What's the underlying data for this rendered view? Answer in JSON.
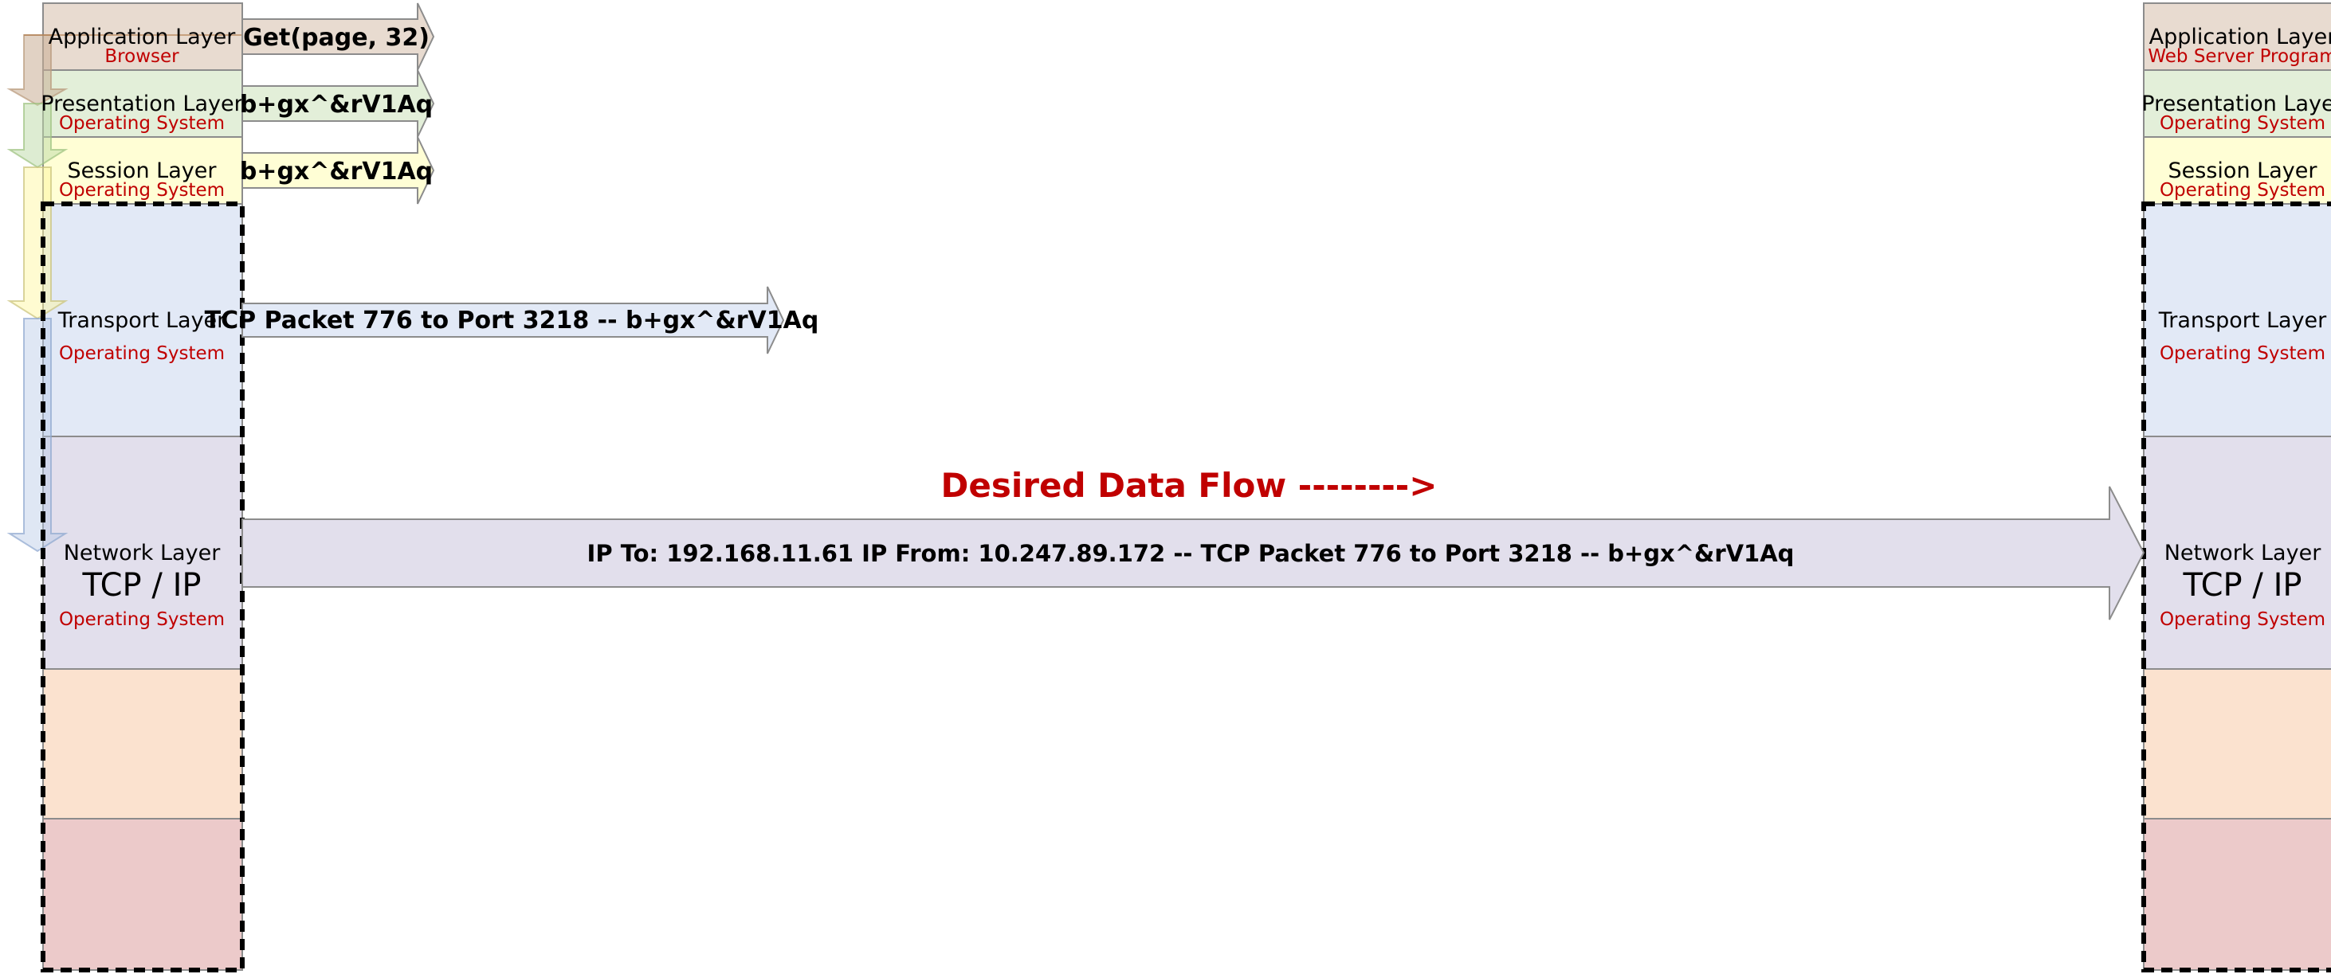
{
  "colors": {
    "application": "#e8dbd0",
    "presentation": "#e3efd9",
    "session": "#fffed5",
    "transport": "#e2e9f6",
    "network": "#e2dfec",
    "datalink": "#fbe2cf",
    "physical": "#eccaca",
    "subtitle": "#c00000",
    "title": "#c00000"
  },
  "left_stack": {
    "application": {
      "name": "Application Layer",
      "sub": "Browser"
    },
    "presentation": {
      "name": "Presentation Layer",
      "sub": "Operating System"
    },
    "session": {
      "name": "Session Layer",
      "sub": "Operating System"
    },
    "transport": {
      "name": "Transport Layer",
      "sub": "Operating System"
    },
    "network": {
      "name": "Network Layer",
      "big": "TCP / IP",
      "sub": "Operating System"
    }
  },
  "right_stack": {
    "application": {
      "name": "Application Layer",
      "sub": "Web  Server Program"
    },
    "presentation": {
      "name": "Presentation Layer",
      "sub": "Operating System"
    },
    "session": {
      "name": "Session Layer",
      "sub": "Operating System"
    },
    "transport": {
      "name": "Transport Layer",
      "sub": "Operating System"
    },
    "network": {
      "name": "Network Layer",
      "big": "TCP / IP",
      "sub": "Operating System"
    }
  },
  "arrows": {
    "application": "Get(page, 32)",
    "presentation": "b+gx^&rV1Aq",
    "session": "b+gx^&rV1Aq",
    "transport": "TCP Packet 776 to Port 3218 -- b+gx^&rV1Aq",
    "network": "IP To: 192.168.11.61 IP From: 10.247.89.172 -- TCP Packet 776 to Port 3218 -- b+gx^&rV1Aq"
  },
  "title": "Desired Data Flow -------->"
}
